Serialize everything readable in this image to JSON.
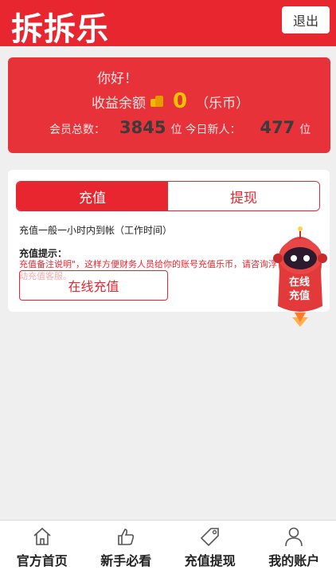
{
  "header": {
    "logo": "拆拆乐",
    "logout_label": "退出"
  },
  "account": {
    "greeting": "你好！",
    "balance_label": "收益余额",
    "balance_value": "0",
    "balance_unit": "（乐币）",
    "members_label": "会员总数：",
    "members_value": "3845",
    "members_unit": "位",
    "new_label": "今日新人：",
    "new_value": "477",
    "new_unit": "位"
  },
  "panel": {
    "tabs": [
      {
        "label": "充值",
        "active": true
      },
      {
        "label": "提现",
        "active": false
      }
    ],
    "note": "充值一般一小时内到帐（工作时间）",
    "tip_title": "充值提示：",
    "tip_text": "充值备注说明\"，这样方便财务人员给你的账号充值乐币，请咨询浮动充值客服。",
    "online_button": "在线充值"
  },
  "mascot": {
    "line1": "在线",
    "line2": "充值"
  },
  "bottom_nav": [
    {
      "label": "官方首页",
      "icon": "home-icon"
    },
    {
      "label": "新手必看",
      "icon": "thumbs-up-icon"
    },
    {
      "label": "充值提现",
      "icon": "tag-icon"
    },
    {
      "label": "我的账户",
      "icon": "user-icon"
    }
  ],
  "colors": {
    "brand_red": "#e8262f",
    "card_red": "#e8323a",
    "gold": "#f5c400"
  }
}
